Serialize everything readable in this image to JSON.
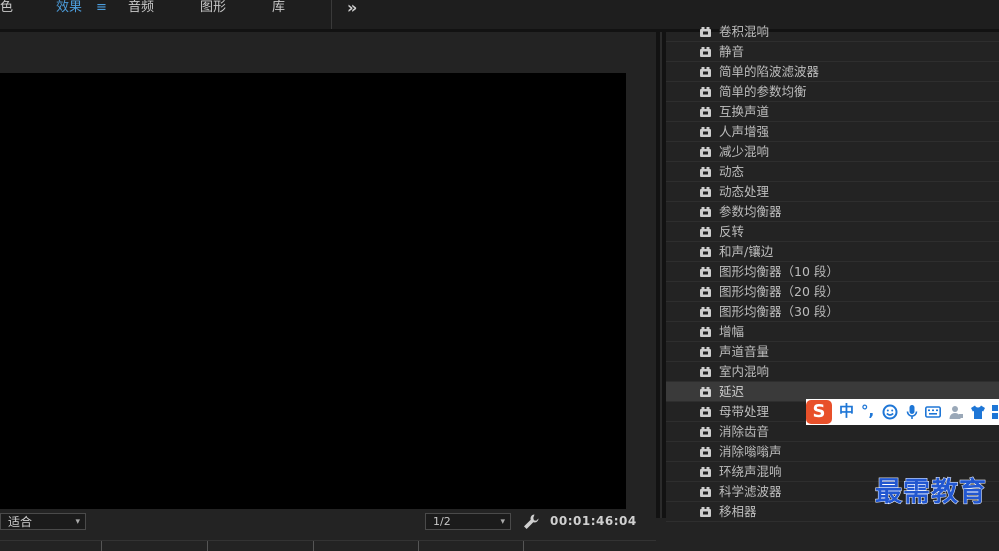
{
  "workspaces": {
    "color": "色",
    "effects": "效果",
    "audio": "音频",
    "graphics": "图形",
    "libraries": "库",
    "more_icon": "double-chevron-right-icon"
  },
  "monitor": {
    "fit_value": "适合",
    "resolution_value": "1/2",
    "timecode": "00:01:46:04",
    "settings_icon": "wrench-icon"
  },
  "effects_list": [
    {
      "label": "卷积混响"
    },
    {
      "label": "静音"
    },
    {
      "label": "简单的陷波滤波器"
    },
    {
      "label": "简单的参数均衡"
    },
    {
      "label": "互换声道"
    },
    {
      "label": "人声增强"
    },
    {
      "label": "减少混响"
    },
    {
      "label": "动态"
    },
    {
      "label": "动态处理"
    },
    {
      "label": "参数均衡器"
    },
    {
      "label": "反转"
    },
    {
      "label": "和声/镶边"
    },
    {
      "label": "图形均衡器（10 段）"
    },
    {
      "label": "图形均衡器（20 段）"
    },
    {
      "label": "图形均衡器（30 段）"
    },
    {
      "label": "增幅"
    },
    {
      "label": "声道音量"
    },
    {
      "label": "室内混响"
    },
    {
      "label": "延迟",
      "selected": true
    },
    {
      "label": "母带处理"
    },
    {
      "label": "消除齿音"
    },
    {
      "label": "消除嗡嗡声"
    },
    {
      "label": "环绕声混响"
    },
    {
      "label": "科学滤波器"
    },
    {
      "label": "移相器"
    }
  ],
  "ime_toolbar": {
    "logo": "S",
    "mode": "中",
    "punct": "°,"
  },
  "watermark": "最需教育",
  "colors": {
    "accent": "#4c9ddc",
    "panel_bg": "#232323",
    "video_bg": "#000000",
    "ime_brand": "#e8502a",
    "watermark": "#2257d0"
  }
}
